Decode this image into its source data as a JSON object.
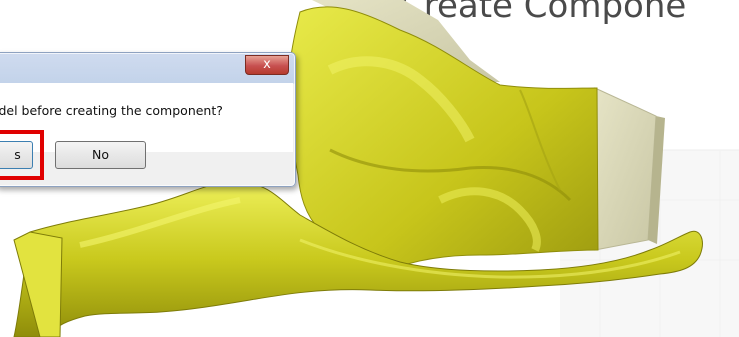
{
  "background": {
    "heading_text": "Create Compone"
  },
  "dialog": {
    "close_label": "x",
    "message": "e model before creating the component?",
    "yes_label": "s",
    "no_label": "No"
  },
  "colors": {
    "model_yellow": "#c9c91d",
    "model_highlight": "#e6e84a",
    "model_shadow": "#8f8d0a",
    "stock_block": "#d9d7b7",
    "highlight_box": "#e00000"
  }
}
